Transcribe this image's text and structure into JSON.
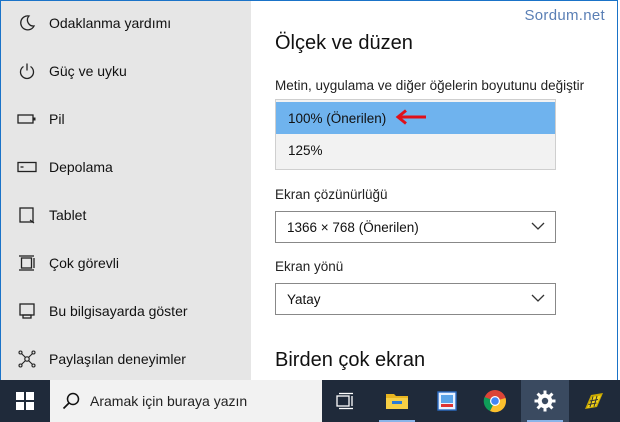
{
  "watermark": "Sordum.net",
  "sidebar": {
    "items": [
      {
        "label": "Odaklanma yardımı",
        "icon": "moon-icon"
      },
      {
        "label": "Güç ve uyku",
        "icon": "power-icon"
      },
      {
        "label": "Pil",
        "icon": "battery-icon"
      },
      {
        "label": "Depolama",
        "icon": "storage-icon"
      },
      {
        "label": "Tablet",
        "icon": "tablet-icon"
      },
      {
        "label": "Çok görevli",
        "icon": "multitasking-icon"
      },
      {
        "label": "Bu bilgisayarda göster",
        "icon": "project-icon"
      },
      {
        "label": "Paylaşılan deneyimler",
        "icon": "share-icon"
      }
    ]
  },
  "main": {
    "section_title": "Ölçek ve düzen",
    "scale_label": "Metin, uygulama ve diğer öğelerin boyutunu değiştir",
    "scale_options": [
      "100% (Önerilen)",
      "125%"
    ],
    "scale_selected": "100% (Önerilen)",
    "resolution_label": "Ekran çözünürlüğü",
    "resolution_value": "1366 × 768 (Önerilen)",
    "orientation_label": "Ekran yönü",
    "orientation_value": "Yatay",
    "multi_display_title": "Birden çok ekran"
  },
  "taskbar": {
    "search_placeholder": "Aramak için buraya yazın",
    "apps": [
      "task-view",
      "file-explorer",
      "photo-app",
      "chrome",
      "settings",
      "app"
    ],
    "accent": "#6fb3ee"
  }
}
